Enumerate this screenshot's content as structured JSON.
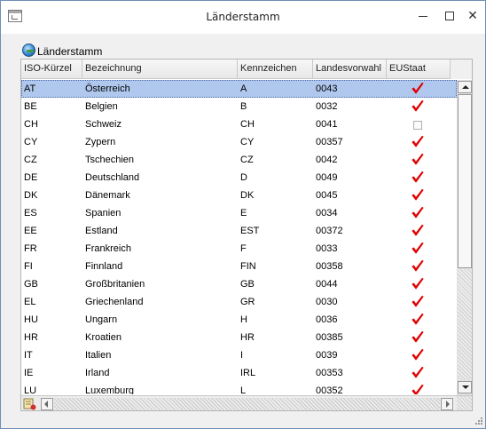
{
  "window": {
    "title": "Länderstamm"
  },
  "panel": {
    "title": "Länderstamm",
    "icon": "globe-icon"
  },
  "columns": {
    "iso": "ISO-Kürzel",
    "name": "Bezeichnung",
    "kz": "Kennzeichen",
    "vorwahl": "Landesvorwahl",
    "eu": "EUStaat"
  },
  "rows": [
    {
      "iso": "AT",
      "name": "Österreich",
      "kz": "A",
      "vorwahl": "0043",
      "eu": true
    },
    {
      "iso": "BE",
      "name": "Belgien",
      "kz": "B",
      "vorwahl": "0032",
      "eu": true
    },
    {
      "iso": "CH",
      "name": "Schweiz",
      "kz": "CH",
      "vorwahl": "0041",
      "eu": false
    },
    {
      "iso": "CY",
      "name": "Zypern",
      "kz": "CY",
      "vorwahl": "00357",
      "eu": true
    },
    {
      "iso": "CZ",
      "name": "Tschechien",
      "kz": "CZ",
      "vorwahl": "0042",
      "eu": true
    },
    {
      "iso": "DE",
      "name": "Deutschland",
      "kz": "D",
      "vorwahl": "0049",
      "eu": true
    },
    {
      "iso": "DK",
      "name": "Dänemark",
      "kz": "DK",
      "vorwahl": "0045",
      "eu": true
    },
    {
      "iso": "ES",
      "name": "Spanien",
      "kz": "E",
      "vorwahl": "0034",
      "eu": true
    },
    {
      "iso": "EE",
      "name": "Estland",
      "kz": "EST",
      "vorwahl": "00372",
      "eu": true
    },
    {
      "iso": "FR",
      "name": "Frankreich",
      "kz": "F",
      "vorwahl": "0033",
      "eu": true
    },
    {
      "iso": "FI",
      "name": "Finnland",
      "kz": "FIN",
      "vorwahl": "00358",
      "eu": true
    },
    {
      "iso": "GB",
      "name": "Großbritanien",
      "kz": "GB",
      "vorwahl": "0044",
      "eu": true
    },
    {
      "iso": "EL",
      "name": "Griechenland",
      "kz": "GR",
      "vorwahl": "0030",
      "eu": true
    },
    {
      "iso": "HU",
      "name": "Ungarn",
      "kz": "H",
      "vorwahl": "0036",
      "eu": true
    },
    {
      "iso": "HR",
      "name": "Kroatien",
      "kz": "HR",
      "vorwahl": "00385",
      "eu": true
    },
    {
      "iso": "IT",
      "name": "Italien",
      "kz": "I",
      "vorwahl": "0039",
      "eu": true
    },
    {
      "iso": "IE",
      "name": "Irland",
      "kz": "IRL",
      "vorwahl": "00353",
      "eu": true
    },
    {
      "iso": "LU",
      "name": "Luxemburg",
      "kz": "L",
      "vorwahl": "00352",
      "eu": true
    }
  ],
  "selected_row": 0,
  "colors": {
    "selection": "#b0c8ee",
    "checkmark": "#e00000",
    "window_border": "#6e8fb5"
  }
}
